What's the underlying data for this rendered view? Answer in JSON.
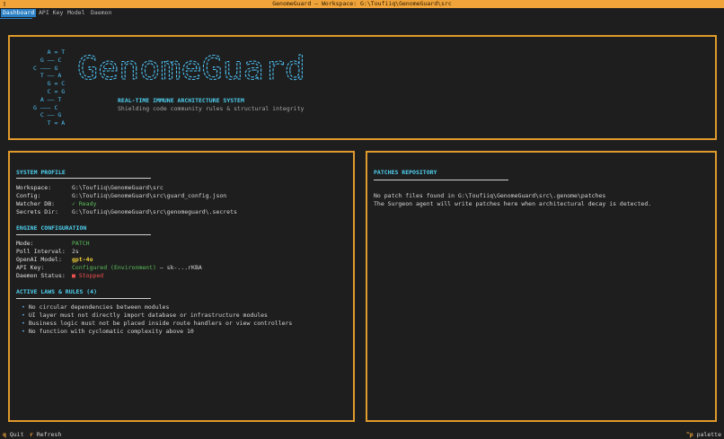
{
  "window": {
    "title": "GenomeGuard — Workspace: G:\\Toufiiq\\GenomeGuard\\src",
    "menu_icon": "▯"
  },
  "tabs": [
    {
      "label": "Dashboard",
      "active": true
    },
    {
      "label": "API Key",
      "active": false
    },
    {
      "label": "Model",
      "active": false
    },
    {
      "label": "Daemon",
      "active": false
    }
  ],
  "banner": {
    "dna_art": [
      "    A = T",
      "  G —— C",
      "C ——— G",
      "  T —— A",
      "    G = C",
      "    C = G",
      "  A —— T",
      "G ——— C",
      "  C —— G",
      "    T = A"
    ],
    "logo_text": "GenomeGuard",
    "tagline": "REAL-TIME IMMUNE ARCHITECTURE SYSTEM",
    "subtitle": "Shielding code community rules & structural integrity"
  },
  "system_profile": {
    "title": "SYSTEM PROFILE",
    "workspace_label": "Workspace:",
    "workspace": "G:\\Toufiiq\\GenomeGuard\\src",
    "config_label": "Config:",
    "config": "G:\\Toufiiq\\GenomeGuard\\src\\guard_config.json",
    "watcher_label": "Watcher DB:",
    "watcher": "✓ Ready",
    "secrets_label": "Secrets Dir:",
    "secrets": "G:\\Toufiiq\\GenomeGuard\\src\\genomeguard\\.secrets"
  },
  "engine": {
    "title": "ENGINE CONFIGURATION",
    "mode_label": "Mode:",
    "mode": "PATCH",
    "poll_label": "Poll Interval:",
    "poll": "2s",
    "model_label": "OpenAI Model:",
    "model": "gpt-4o",
    "api_label": "API Key:",
    "api_status": "Configured (Environment)",
    "api_masked": " — sk-...rKBA",
    "daemon_label": "Daemon Status:",
    "daemon": "■ Stopped"
  },
  "rules": {
    "title": "ACTIVE LAWS & RULES (4)",
    "items": [
      "No circular dependencies between modules",
      "UI layer must not directly import database or infrastructure modules",
      "Business logic must not be placed inside route handlers or view controllers",
      "No function with cyclomatic complexity above 10"
    ]
  },
  "patches": {
    "title": "PATCHES REPOSITORY",
    "line1": "No patch files found in G:\\Toufiiq\\GenomeGuard\\src\\.genome\\patches",
    "line2": "The Surgeon agent will write patches here when architectural decay is detected."
  },
  "footer": {
    "quit_key": "q",
    "quit_label": "Quit",
    "refresh_key": "r",
    "refresh_label": "Refresh",
    "palette_key": "^p",
    "palette_label": "palette"
  },
  "colors": {
    "accent": "#f0a43a",
    "cyan": "#4fd0f0",
    "tab_active": "#2a7fc4",
    "ready": "#5bbf5b",
    "stopped": "#f05050",
    "model": "#f1d23a"
  }
}
